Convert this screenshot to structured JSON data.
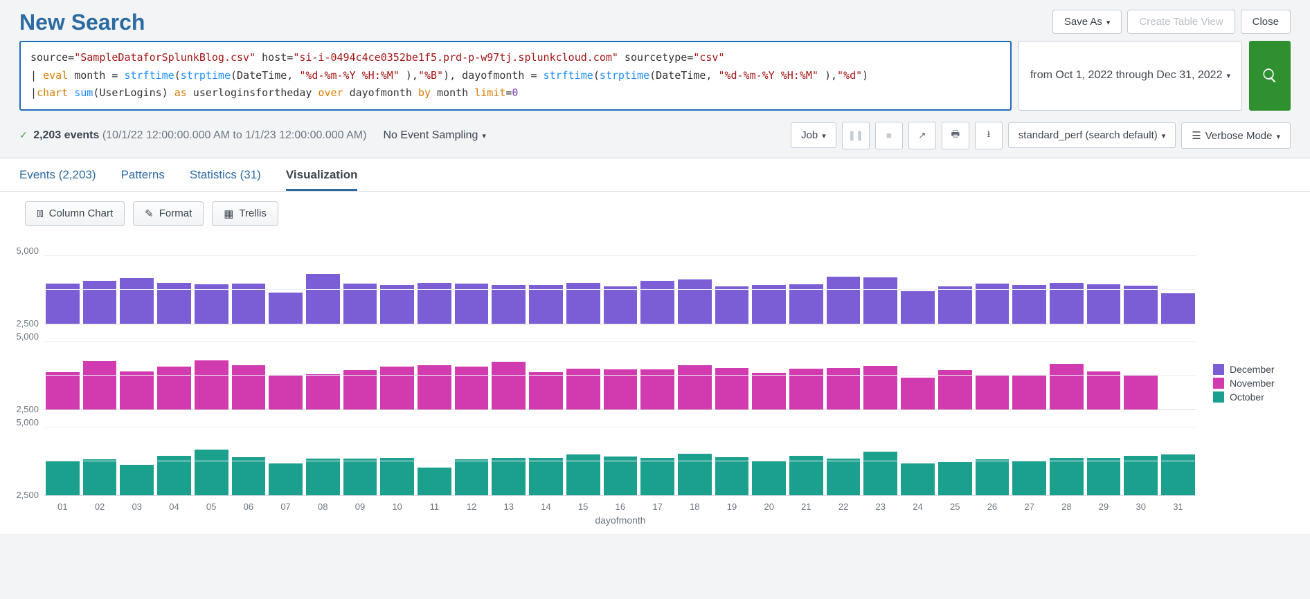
{
  "title": "New Search",
  "top_actions": {
    "save_as": "Save As",
    "create_table": "Create Table View",
    "close": "Close"
  },
  "search_query": "source=\"SampleDataforSplunkBlog.csv\" host=\"si-i-0494c4ce0352be1f5.prd-p-w97tj.splunkcloud.com\" sourcetype=\"csv\"\n| eval month = strftime(strptime(DateTime, \"%d-%m-%Y %H:%M\" ),\"%B\"), dayofmonth = strftime(strptime(DateTime, \"%d-%m-%Y %H:%M\" ),\"%d\")\n|chart sum(UserLogins) as userloginsfortheday over dayofmonth by month limit=0",
  "time_range_label": "from Oct 1, 2022 through Dec 31, 2022",
  "status": {
    "events_count": "2,203 events",
    "time_range": "(10/1/22 12:00:00.000 AM to 1/1/23 12:00:00.000 AM)",
    "sampling": "No Event Sampling",
    "job": "Job",
    "perf": "standard_perf (search default)",
    "verbose": "Verbose Mode"
  },
  "tabs": {
    "events": "Events (2,203)",
    "patterns": "Patterns",
    "statistics": "Statistics (31)",
    "visualization": "Visualization"
  },
  "viz_toolbar": {
    "chart_type": "Column Chart",
    "format": "Format",
    "trellis": "Trellis"
  },
  "legend": {
    "december": "December",
    "november": "November",
    "october": "October"
  },
  "chart_data": {
    "type": "bar",
    "title": "",
    "xlabel": "dayofmonth",
    "ylabel": "",
    "ylim": [
      0,
      5000
    ],
    "y_ticks": [
      5000,
      2500
    ],
    "categories": [
      "01",
      "02",
      "03",
      "04",
      "05",
      "06",
      "07",
      "08",
      "09",
      "10",
      "11",
      "12",
      "13",
      "14",
      "15",
      "16",
      "17",
      "18",
      "19",
      "20",
      "21",
      "22",
      "23",
      "24",
      "25",
      "26",
      "27",
      "28",
      "29",
      "30",
      "31"
    ],
    "series": [
      {
        "name": "December",
        "color": "#7b5dd6",
        "values": [
          2900,
          3100,
          3300,
          2950,
          2850,
          2900,
          2250,
          3600,
          2900,
          2800,
          2950,
          2900,
          2800,
          2800,
          2950,
          2700,
          3100,
          3200,
          2700,
          2800,
          2850,
          3400,
          3350,
          2350,
          2700,
          2900,
          2800,
          2950,
          2850,
          2750,
          2200
        ]
      },
      {
        "name": "November",
        "color": "#d13baf",
        "values": [
          2700,
          3500,
          2750,
          3100,
          3550,
          3200,
          2500,
          2550,
          2850,
          3100,
          3200,
          3100,
          3450,
          2700,
          2950,
          2900,
          2900,
          3200,
          3000,
          2650,
          2950,
          3000,
          3150,
          2300,
          2850,
          2500,
          2500,
          3300,
          2750,
          2500,
          0
        ]
      },
      {
        "name": "October",
        "color": "#1ca08e",
        "values": [
          2500,
          2600,
          2200,
          2850,
          3300,
          2750,
          2300,
          2650,
          2650,
          2700,
          2000,
          2600,
          2700,
          2700,
          2950,
          2800,
          2700,
          3000,
          2750,
          2500,
          2850,
          2650,
          3150,
          2300,
          2400,
          2600,
          2500,
          2700,
          2700,
          2850,
          2950
        ]
      }
    ]
  }
}
